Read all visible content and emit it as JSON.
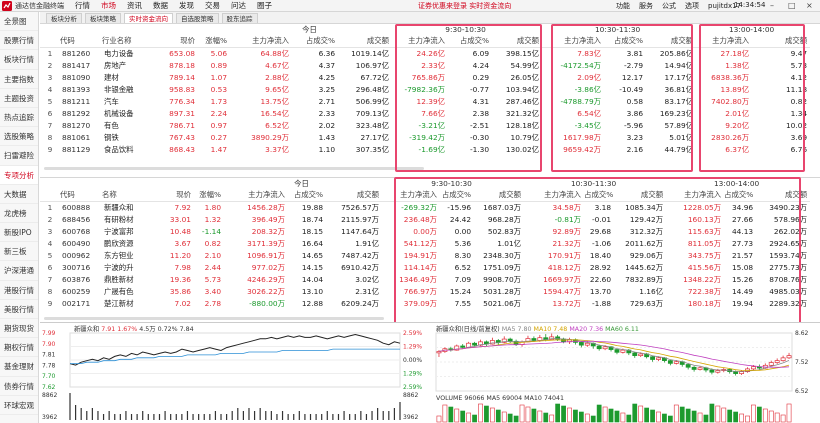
{
  "app": {
    "title": "通达信金融终端",
    "clock": "14:34:54"
  },
  "menu": [
    "行情",
    "市场",
    "资讯",
    "数据",
    "发现",
    "交易",
    "问达",
    "圈子"
  ],
  "menu_active": 1,
  "top_links": "证券优惠来登录  实时资金流向",
  "top_right": [
    "功能",
    "服务",
    "公式",
    "选项",
    "pujitdx17"
  ],
  "sidebar": [
    "全景图",
    "股票行情",
    "板块行情",
    "主要指数",
    "主题投资",
    "热点追踪",
    "选股策略",
    "扫雷避险",
    "专项分析",
    "大数据",
    "龙虎榜",
    "新股IPO",
    "新三板",
    "沪深港通",
    "港股行情",
    "美股行情",
    "期货现货",
    "期权行情",
    "基金理财",
    "债券行情",
    "环球宏观"
  ],
  "sidebar_active": 8,
  "subtabs": [
    "板块分析",
    "板块策略",
    "实时资金流向",
    "自选股策略",
    "股东追踪"
  ],
  "subtab_active": 2,
  "table_groups": [
    "今日",
    "9:30-10:30",
    "10:30-11:30",
    "13:00-14:00"
  ],
  "table1": {
    "headers": [
      "",
      "代码",
      "行业名称",
      "现价",
      "涨幅%",
      "主力净流入",
      "占成交%",
      "成交额",
      "主力净流入",
      "占成交%",
      "成交额",
      "主力净流入",
      "占成交%",
      "成交额",
      "主力净流入",
      "成交额"
    ],
    "rows": [
      [
        "1",
        "881260",
        "电力设备",
        "653.08",
        "5.06",
        "64.88亿",
        "6.36",
        "1019.14亿",
        "24.26亿",
        "6.09",
        "398.15亿",
        "7.83亿",
        "3.81",
        "205.86亿",
        "27.18亿",
        "9.47"
      ],
      [
        "2",
        "881417",
        "房地产",
        "878.18",
        "0.89",
        "4.67亿",
        "4.37",
        "106.97亿",
        "2.33亿",
        "4.24",
        "54.99亿",
        "-4172.54万",
        "-2.79",
        "14.94亿",
        "1.38亿",
        "5.73"
      ],
      [
        "3",
        "881090",
        "建材",
        "789.14",
        "1.07",
        "2.88亿",
        "4.25",
        "67.72亿",
        "765.86万",
        "0.29",
        "26.05亿",
        "2.09亿",
        "12.17",
        "17.17亿",
        "6838.36万",
        "4.12"
      ],
      [
        "4",
        "881393",
        "非银金融",
        "958.83",
        "0.53",
        "9.65亿",
        "3.25",
        "296.48亿",
        "-7982.36万",
        "-0.77",
        "103.94亿",
        "-3.86亿",
        "-10.49",
        "36.81亿",
        "13.89亿",
        "11.18"
      ],
      [
        "5",
        "881211",
        "汽车",
        "776.34",
        "1.73",
        "13.75亿",
        "2.71",
        "506.99亿",
        "12.39亿",
        "4.31",
        "287.46亿",
        "-4788.79万",
        "0.58",
        "83.17亿",
        "7402.80万",
        "0.82"
      ],
      [
        "6",
        "881292",
        "机械设备",
        "897.31",
        "2.24",
        "16.54亿",
        "2.33",
        "709.13亿",
        "7.66亿",
        "2.38",
        "321.32亿",
        "6.54亿",
        "3.86",
        "169.23亿",
        "2.01亿",
        "1.34"
      ],
      [
        "7",
        "881270",
        "有色",
        "786.71",
        "0.97",
        "6.52亿",
        "2.02",
        "323.48亿",
        "-3.21亿",
        "-2.51",
        "128.18亿",
        "-3.45亿",
        "-5.96",
        "57.89亿",
        "9.20亿",
        "10.02"
      ],
      [
        "8",
        "881061",
        "钢铁",
        "767.43",
        "0.27",
        "3890.29万",
        "1.43",
        "27.17亿",
        "-319.42万",
        "-0.30",
        "10.79亿",
        "1617.98万",
        "3.23",
        "5.01亿",
        "2830.26万",
        "3.69"
      ],
      [
        "9",
        "881129",
        "食品饮料",
        "868.43",
        "1.47",
        "3.37亿",
        "1.10",
        "307.35亿",
        "-1.69亿",
        "-1.30",
        "130.02亿",
        "9659.42万",
        "2.16",
        "44.79亿",
        "6.37亿",
        "6.76"
      ]
    ]
  },
  "table2": {
    "headers": [
      "",
      "代码",
      "名称",
      "现价",
      "涨幅%",
      "主力净流入",
      "占成交%",
      "成交额",
      "主力净流入",
      "占成交%",
      "成交额",
      "主力净流入",
      "占成交%",
      "成交额",
      "主力净流入",
      "占成交%",
      "成交额"
    ],
    "rows": [
      [
        "1",
        "600888",
        "新疆众和",
        "7.92",
        "1.80",
        "1456.28万",
        "19.88",
        "7526.57万",
        "-269.32万",
        "-15.96",
        "1687.03万",
        "34.58万",
        "3.18",
        "1085.34万",
        "1228.05万",
        "34.96",
        "3490.23万"
      ],
      [
        "2",
        "688456",
        "有研粉材",
        "33.01",
        "1.32",
        "396.49万",
        "18.74",
        "2115.97万",
        "236.48万",
        "24.42",
        "968.28万",
        "-0.81万",
        "-0.01",
        "129.42万",
        "160.13万",
        "27.66",
        "578.96万"
      ],
      [
        "3",
        "600768",
        "宁波富邦",
        "10.48",
        "-1.14",
        "208.32万",
        "18.15",
        "1147.64万",
        "0.00万",
        "0.00",
        "502.83万",
        "92.89万",
        "29.68",
        "312.32万",
        "115.63万",
        "44.13",
        "262.02万"
      ],
      [
        "4",
        "600490",
        "鹏欣资源",
        "3.67",
        "0.82",
        "3171.39万",
        "16.64",
        "1.91亿",
        "541.12万",
        "5.36",
        "1.01亿",
        "21.32万",
        "-1.06",
        "2011.62万",
        "811.05万",
        "27.73",
        "2924.65万"
      ],
      [
        "5",
        "000962",
        "东方钽业",
        "11.20",
        "2.10",
        "1096.91万",
        "14.65",
        "7487.42万",
        "194.91万",
        "8.30",
        "2348.30万",
        "170.91万",
        "18.40",
        "929.06万",
        "343.75万",
        "21.57",
        "1593.74万"
      ],
      [
        "6",
        "300716",
        "宁波的升",
        "7.98",
        "2.44",
        "977.02万",
        "14.15",
        "6910.42万",
        "114.14万",
        "6.52",
        "1751.09万",
        "418.12万",
        "28.92",
        "1445.62万",
        "415.56万",
        "15.08",
        "2775.73万"
      ],
      [
        "7",
        "603876",
        "鼎胜新材",
        "19.36",
        "5.73",
        "4246.29万",
        "14.04",
        "3.02亿",
        "1346.49万",
        "7.09",
        "9908.70万",
        "1669.97万",
        "22.60",
        "7832.89万",
        "1348.22万",
        "15.26",
        "8708.76万"
      ],
      [
        "8",
        "600259",
        "广晟有色",
        "35.86",
        "3.40",
        "3026.22万",
        "13.10",
        "2.31亿",
        "766.97万",
        "15.24",
        "5031.28万",
        "1594.47万",
        "13.70",
        "1.16亿",
        "722.38万",
        "14.49",
        "4985.03万"
      ],
      [
        "9",
        "002171",
        "楚江新材",
        "7.02",
        "2.78",
        "-880.00万",
        "12.88",
        "6209.24万",
        "379.09万",
        "7.55",
        "5021.06万",
        "13.72万",
        "-1.88",
        "729.63万",
        "180.18万",
        "19.94",
        "2289.32万"
      ]
    ]
  },
  "intraday": {
    "name": "新疆众和",
    "price": "7.91",
    "pct": "1.67%",
    "vol_label": "4.5万",
    "ratio_label": "0.72%",
    "extra": "7.84",
    "y_labels": [
      "7.99",
      "7.90",
      "7.81",
      "7.78",
      "7.70",
      "7.62"
    ],
    "pct_labels": [
      "2.59%",
      "1.29%",
      "0.00%",
      "1.29%",
      "2.59%"
    ],
    "vol_labels": [
      "8862",
      "3962"
    ]
  },
  "kline": {
    "title": "新疆众和(日线/前复权)",
    "ma5": "MA5 7.80",
    "ma10": "MA10 7.48",
    "ma20": "MA20 7.36",
    "ma60": "MA60 6.11",
    "y_labels": [
      "8.62",
      "7.52",
      "6.52"
    ],
    "vol_header": "VOLUME 96066  MA5 69004  MA10 74041"
  },
  "chart_data": [
    {
      "type": "line",
      "title": "新疆众和",
      "x_count": 60,
      "series": [
        {
          "values": [
            7.78,
            7.77,
            7.79,
            7.8,
            7.81,
            7.8,
            7.82,
            7.81,
            7.83,
            7.84,
            7.83,
            7.85,
            7.84,
            7.86,
            7.85,
            7.84,
            7.85,
            7.86,
            7.85,
            7.86,
            7.88,
            7.87,
            7.86,
            7.87,
            7.88,
            7.89,
            7.88,
            7.87,
            7.89,
            7.9,
            7.91,
            7.92,
            7.93,
            7.94,
            7.95,
            7.95,
            7.96,
            7.95,
            7.96,
            7.97,
            7.96,
            7.97,
            7.96,
            7.96,
            7.97,
            7.96,
            7.95,
            7.96,
            7.97,
            7.96,
            7.97,
            7.98,
            7.97,
            7.96,
            7.95,
            7.94,
            7.92,
            7.91,
            7.93,
            7.92
          ]
        },
        {
          "values": [
            7.78,
            7.78,
            7.78,
            7.79,
            7.79,
            7.79,
            7.8,
            7.8,
            7.8,
            7.81,
            7.81,
            7.81,
            7.82,
            7.82,
            7.82,
            7.82,
            7.83,
            7.83,
            7.83,
            7.83,
            7.83,
            7.84,
            7.84,
            7.84,
            7.84,
            7.84,
            7.84,
            7.85,
            7.85,
            7.85,
            7.85,
            7.85,
            7.86,
            7.86,
            7.86,
            7.86,
            7.86,
            7.86,
            7.87,
            7.87,
            7.87,
            7.87,
            7.87,
            7.87,
            7.87,
            7.87,
            7.87,
            7.88,
            7.88,
            7.88,
            7.88,
            7.88,
            7.88,
            7.88,
            7.88,
            7.88,
            7.88,
            7.88,
            7.88,
            7.88
          ]
        }
      ],
      "volume": [
        9,
        5,
        4,
        3,
        4,
        3,
        2,
        3,
        2,
        2,
        3,
        2,
        2,
        3,
        2,
        2,
        2,
        3,
        2,
        2,
        2,
        3,
        2,
        2,
        2,
        2,
        3,
        2,
        2,
        3,
        4,
        3,
        4,
        3,
        4,
        3,
        3,
        2,
        3,
        2,
        2,
        3,
        2,
        2,
        2,
        2,
        3,
        2,
        2,
        3,
        2,
        2,
        3,
        2,
        3,
        4,
        3,
        3,
        4,
        6
      ],
      "ylim": [
        7.62,
        7.99
      ]
    },
    {
      "type": "candlestick",
      "title": "新疆众和(日线/前复权)",
      "ylim": [
        6.52,
        8.62
      ],
      "candles": [
        [
          7.9,
          7.95,
          7.75,
          8.0
        ],
        [
          7.95,
          8.05,
          7.9,
          8.1
        ],
        [
          8.05,
          8.0,
          7.95,
          8.12
        ],
        [
          8.0,
          8.15,
          7.98,
          8.2
        ],
        [
          8.15,
          8.1,
          8.05,
          8.22
        ],
        [
          8.1,
          8.25,
          8.08,
          8.3
        ],
        [
          8.25,
          8.18,
          8.12,
          8.3
        ],
        [
          8.18,
          8.3,
          8.15,
          8.38
        ],
        [
          8.3,
          8.22,
          8.15,
          8.35
        ],
        [
          8.22,
          8.35,
          8.2,
          8.45
        ],
        [
          8.35,
          8.28,
          8.2,
          8.4
        ],
        [
          8.28,
          8.4,
          8.25,
          8.5
        ],
        [
          8.4,
          8.32,
          8.25,
          8.45
        ],
        [
          8.32,
          8.2,
          8.15,
          8.38
        ],
        [
          8.2,
          8.3,
          8.12,
          8.35
        ],
        [
          8.3,
          8.42,
          8.28,
          8.52
        ],
        [
          8.42,
          8.35,
          8.3,
          8.5
        ],
        [
          8.35,
          8.45,
          8.3,
          8.55
        ],
        [
          8.45,
          8.38,
          8.32,
          8.58
        ],
        [
          8.38,
          8.48,
          8.35,
          8.6
        ],
        [
          8.48,
          8.4,
          8.33,
          8.55
        ],
        [
          8.4,
          8.3,
          8.25,
          8.45
        ],
        [
          8.3,
          8.38,
          8.22,
          8.45
        ],
        [
          8.38,
          8.28,
          8.2,
          8.42
        ],
        [
          8.28,
          8.18,
          8.1,
          8.32
        ],
        [
          8.18,
          8.25,
          8.12,
          8.32
        ],
        [
          8.25,
          8.15,
          8.05,
          8.28
        ],
        [
          8.15,
          8.05,
          7.98,
          8.2
        ],
        [
          8.05,
          8.12,
          8.0,
          8.18
        ],
        [
          8.12,
          8.02,
          7.95,
          8.15
        ],
        [
          8.02,
          7.92,
          7.85,
          8.06
        ],
        [
          7.92,
          8.0,
          7.88,
          8.06
        ],
        [
          8.0,
          7.9,
          7.82,
          8.04
        ],
        [
          7.9,
          7.8,
          7.72,
          7.94
        ],
        [
          7.8,
          7.86,
          7.75,
          7.92
        ],
        [
          7.86,
          7.76,
          7.7,
          7.9
        ],
        [
          7.76,
          7.66,
          7.58,
          7.8
        ],
        [
          7.66,
          7.72,
          7.6,
          7.78
        ],
        [
          7.72,
          7.62,
          7.55,
          7.75
        ],
        [
          7.62,
          7.52,
          7.45,
          7.66
        ],
        [
          7.52,
          7.58,
          7.48,
          7.64
        ],
        [
          7.58,
          7.48,
          7.4,
          7.62
        ],
        [
          7.48,
          7.38,
          7.3,
          7.52
        ],
        [
          7.38,
          7.3,
          7.22,
          7.42
        ],
        [
          7.3,
          7.36,
          7.26,
          7.42
        ],
        [
          7.36,
          7.28,
          7.2,
          7.4
        ],
        [
          7.28,
          7.2,
          7.12,
          7.34
        ],
        [
          7.2,
          7.26,
          7.15,
          7.32
        ],
        [
          7.26,
          7.3,
          7.2,
          7.36
        ],
        [
          7.3,
          7.22,
          7.15,
          7.34
        ],
        [
          7.22,
          7.15,
          7.08,
          7.26
        ],
        [
          7.15,
          7.22,
          7.1,
          7.28
        ],
        [
          7.22,
          7.32,
          7.18,
          7.38
        ],
        [
          7.32,
          7.4,
          7.28,
          7.46
        ],
        [
          7.4,
          7.35,
          7.3,
          7.48
        ],
        [
          7.35,
          7.45,
          7.32,
          7.52
        ],
        [
          7.45,
          7.55,
          7.42,
          7.62
        ],
        [
          7.55,
          7.62,
          7.5,
          7.7
        ],
        [
          7.62,
          7.72,
          7.58,
          7.8
        ],
        [
          7.72,
          7.8,
          7.68,
          7.9
        ]
      ]
    }
  ]
}
